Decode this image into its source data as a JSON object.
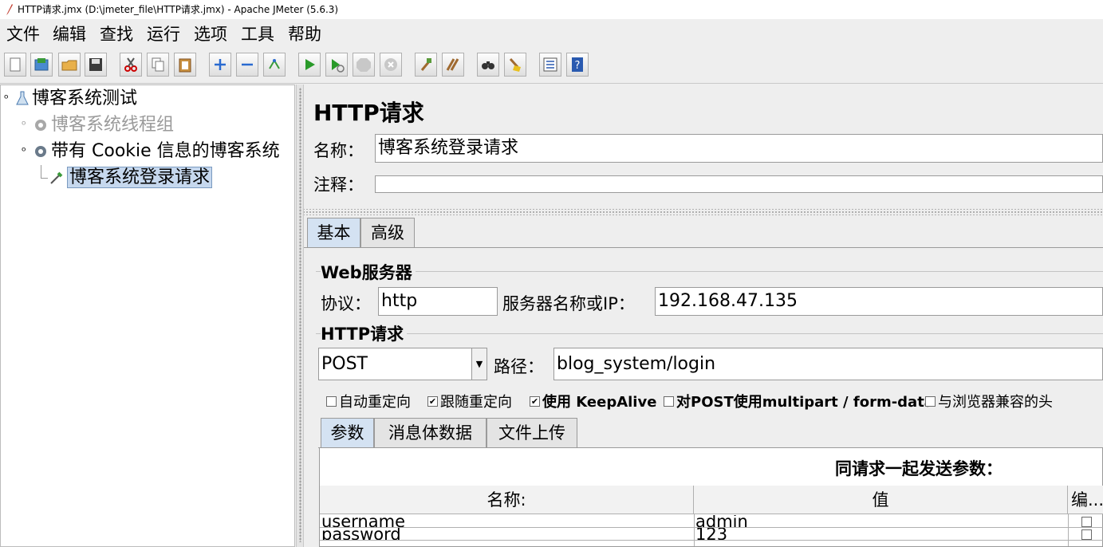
{
  "window": {
    "title": "HTTP请求.jmx (D:\\jmeter_file\\HTTP请求.jmx) - Apache JMeter (5.6.3)"
  },
  "menu": [
    "文件",
    "编辑",
    "查找",
    "运行",
    "选项",
    "工具",
    "帮助"
  ],
  "toolbar": [
    "new-icon",
    "templates-icon",
    "open-icon",
    "save-icon",
    "cut-icon",
    "copy-icon",
    "paste-icon",
    "expand-icon",
    "collapse-icon",
    "toggle-icon",
    "start-icon",
    "start-no-pause-icon",
    "stop-icon",
    "shutdown-icon",
    "clear-icon",
    "clear-all-icon",
    "search-icon",
    "reset-search-icon",
    "function-helper-icon",
    "help-icon"
  ],
  "tree": {
    "root": "博客系统测试",
    "thread_group": "博客系统线程组",
    "cookie_group": "带有 Cookie 信息的博客系统",
    "sampler": "博客系统登录请求"
  },
  "panel": {
    "heading": "HTTP请求",
    "name_label": "名称：",
    "name_value": "博客系统登录请求",
    "comment_label": "注释：",
    "comment_value": ""
  },
  "tabs": [
    "基本",
    "高级"
  ],
  "web_server": {
    "title": "Web服务器",
    "protocol_label": "协议：",
    "protocol_value": "http",
    "server_label": "服务器名称或IP：",
    "server_value": "192.168.47.135"
  },
  "http_request": {
    "title": "HTTP请求",
    "method": "POST",
    "path_label": "路径：",
    "path_value": "blog_system/login"
  },
  "options": [
    {
      "label": "自动重定向",
      "checked": false
    },
    {
      "label": "跟随重定向",
      "checked": true
    },
    {
      "label": "使用 KeepAlive",
      "checked": true
    },
    {
      "label": "对POST使用multipart / form-data",
      "checked": false
    },
    {
      "label": "与浏览器兼容的头",
      "checked": false
    }
  ],
  "sub_tabs": [
    "参数",
    "消息体数据",
    "文件上传"
  ],
  "params": {
    "title": "同请求一起发送参数：",
    "columns": [
      "名称:",
      "值",
      "编..."
    ],
    "rows": [
      {
        "name": "username",
        "value": "admin"
      },
      {
        "name": "password",
        "value": "123"
      }
    ]
  }
}
